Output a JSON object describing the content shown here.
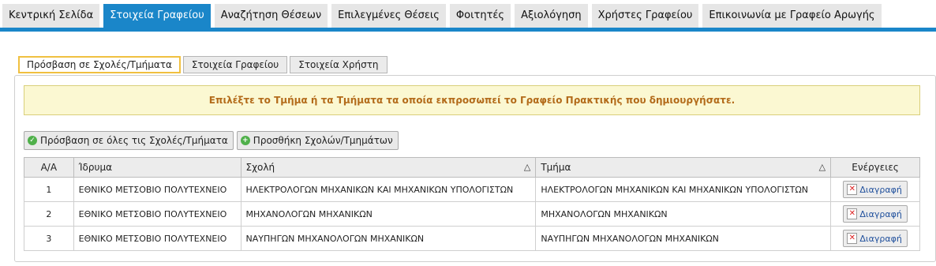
{
  "nav": {
    "items": [
      {
        "label": "Κεντρική Σελίδα",
        "active": false
      },
      {
        "label": "Στοιχεία Γραφείου",
        "active": true
      },
      {
        "label": "Αναζήτηση Θέσεων",
        "active": false
      },
      {
        "label": "Επιλεγμένες Θέσεις",
        "active": false
      },
      {
        "label": "Φοιτητές",
        "active": false
      },
      {
        "label": "Αξιολόγηση",
        "active": false
      },
      {
        "label": "Χρήστες Γραφείου",
        "active": false
      },
      {
        "label": "Επικοινωνία με Γραφείο Αρωγής",
        "active": false
      }
    ],
    "accent_color": "#1a86c9"
  },
  "subtabs": [
    {
      "label": "Πρόσβαση σε Σχολές/Τμήματα",
      "active": true
    },
    {
      "label": "Στοιχεία Γραφείου",
      "active": false
    },
    {
      "label": "Στοιχεία Χρήστη",
      "active": false
    }
  ],
  "info_message": "Επιλέξτε το Τμήμα ή τα Τμήματα τα οποία εκπροσωπεί το Γραφείο Πρακτικής που δημιουργήσατε.",
  "actions": {
    "access_all_label": "Πρόσβαση σε όλες τις Σχολές/Τμήματα",
    "add_label": "Προσθήκη Σχολών/Τμημάτων",
    "access_all_icon": "check-circle-icon",
    "add_icon": "plus-circle-icon"
  },
  "table": {
    "headers": {
      "index": "Α/Α",
      "institution": "Ίδρυμα",
      "school": "Σχολή",
      "department": "Τμήμα",
      "actions": "Ενέργειες"
    },
    "sort_icon": "sort-triangle-icon",
    "rows": [
      {
        "index": "1",
        "institution": "ΕΘΝΙΚΟ ΜΕΤΣΟΒΙΟ ΠΟΛΥΤΕΧΝΕΙΟ",
        "school": "ΗΛΕΚΤΡΟΛΟΓΩΝ ΜΗΧΑΝΙΚΩΝ ΚΑΙ ΜΗΧΑΝΙΚΩΝ ΥΠΟΛΟΓΙΣΤΩΝ",
        "department": "ΗΛΕΚΤΡΟΛΟΓΩΝ ΜΗΧΑΝΙΚΩΝ ΚΑΙ ΜΗΧΑΝΙΚΩΝ ΥΠΟΛΟΓΙΣΤΩΝ",
        "delete_label": "Διαγραφή"
      },
      {
        "index": "2",
        "institution": "ΕΘΝΙΚΟ ΜΕΤΣΟΒΙΟ ΠΟΛΥΤΕΧΝΕΙΟ",
        "school": "ΜΗΧΑΝΟΛΟΓΩΝ ΜΗΧΑΝΙΚΩΝ",
        "department": "ΜΗΧΑΝΟΛΟΓΩΝ ΜΗΧΑΝΙΚΩΝ",
        "delete_label": "Διαγραφή"
      },
      {
        "index": "3",
        "institution": "ΕΘΝΙΚΟ ΜΕΤΣΟΒΙΟ ΠΟΛΥΤΕΧΝΕΙΟ",
        "school": "ΝΑΥΠΗΓΩΝ ΜΗΧΑΝΟΛΟΓΩΝ ΜΗΧΑΝΙΚΩΝ",
        "department": "ΝΑΥΠΗΓΩΝ ΜΗΧΑΝΟΛΟΓΩΝ ΜΗΧΑΝΙΚΩΝ",
        "delete_label": "Διαγραφή"
      }
    ]
  }
}
